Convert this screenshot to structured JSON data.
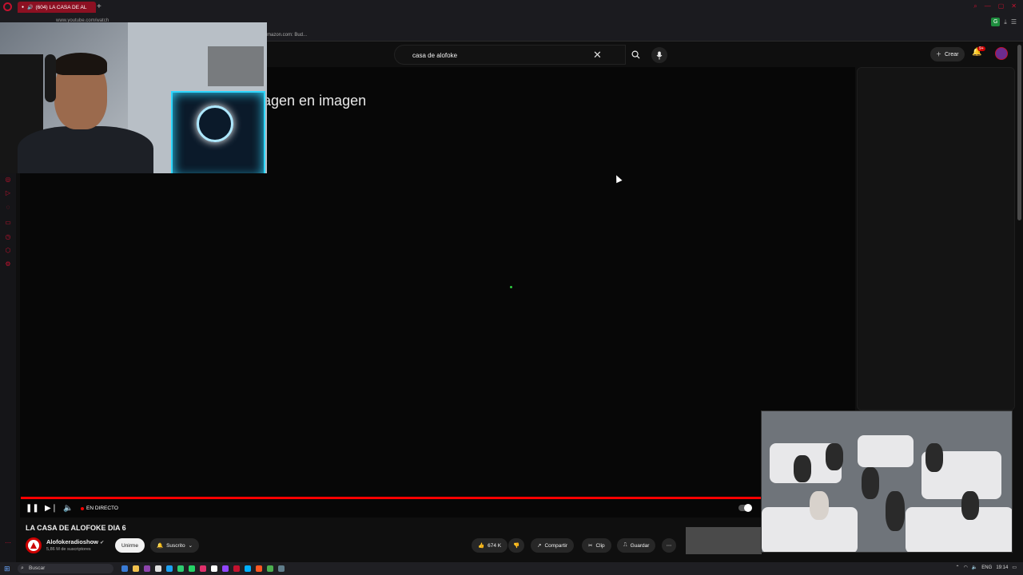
{
  "browser": {
    "tab_title": "(604) LA CASA DE AL",
    "url": "www.youtube.com/watch",
    "bookmark_amazon": "mazon.com: Bud...",
    "ext_badge": "G"
  },
  "header": {
    "search_value": "casa de alofoke",
    "create_label": "Crear",
    "notif_count": "9+"
  },
  "player": {
    "pip_message": "agen en imagen",
    "live_label": "EN DIRECTO"
  },
  "video": {
    "title": "LA CASA DE ALOFOKE DIA 6",
    "channel": "Alofokeradioshow",
    "subscribers": "5,86 M de suscriptores",
    "join_label": "Unirme",
    "subscribed_label": "Suscrito",
    "likes": "674 K",
    "share_label": "Compartir",
    "clip_label": "Clip",
    "save_label": "Guardar"
  },
  "taskbar": {
    "search_placeholder": "Buscar",
    "lang": "ENG",
    "time": "19:14"
  },
  "colors": {
    "accent": "#ff0000",
    "opera": "#c4122f"
  }
}
